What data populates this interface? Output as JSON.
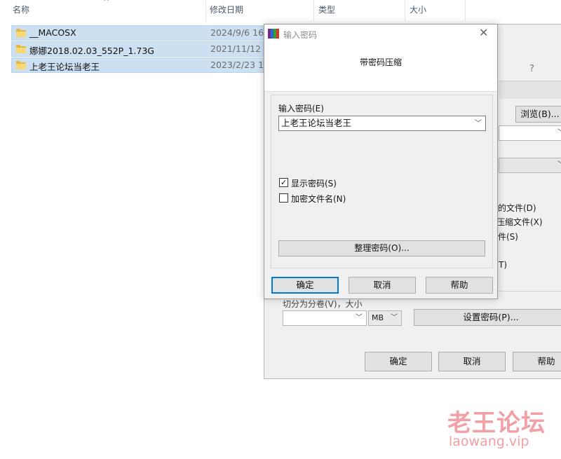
{
  "explorer": {
    "columns": {
      "name": "名称",
      "modified": "修改日期",
      "type": "类型",
      "size": "大小"
    },
    "files": [
      {
        "name": "__MACOSX",
        "date": "2024/9/6 16:"
      },
      {
        "name": "娜娜2018.02.03_552P_1.73G",
        "date": "2021/11/12"
      },
      {
        "name": "上老王论坛当老王",
        "date": "2023/2/23 1"
      }
    ]
  },
  "archive_dialog": {
    "help_q": "?",
    "browse_button": "浏览(B)...",
    "options": [
      "的文件(D)",
      "压缩文件(X)",
      "件(S)",
      "T)"
    ],
    "split_label": "切分为分卷(V)，大小",
    "split_unit": "MB",
    "set_password_button": "设置密码(P)...",
    "ok_button": "确定",
    "cancel_button": "取消",
    "help_button": "帮助"
  },
  "password_dialog": {
    "title": "输入密码",
    "heading": "带密码压缩",
    "password_label": "输入密码(E)",
    "password_value": "上老王论坛当老王",
    "show_password_label": "显示密码(S)",
    "show_password_checked": "✓",
    "encrypt_filenames_label": "加密文件名(N)",
    "organize_button": "整理密码(O)...",
    "ok_button": "确定",
    "cancel_button": "取消",
    "help_button": "帮助"
  },
  "watermark": {
    "cn": "老王论坛",
    "url": "laowang.vip"
  }
}
